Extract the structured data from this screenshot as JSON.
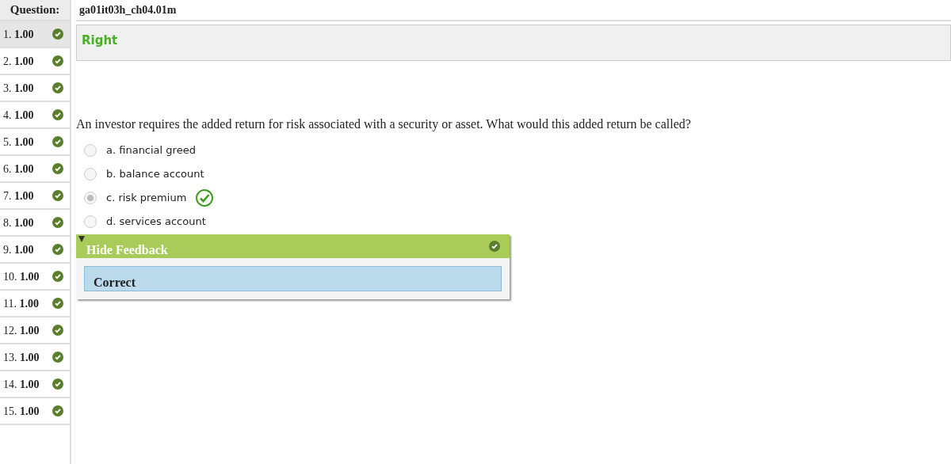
{
  "sidebar": {
    "heading": "Question:",
    "questions": [
      {
        "number": "1.",
        "score": "1.00",
        "correct": true,
        "selected": true
      },
      {
        "number": "2.",
        "score": "1.00",
        "correct": true,
        "selected": false
      },
      {
        "number": "3.",
        "score": "1.00",
        "correct": true,
        "selected": false
      },
      {
        "number": "4.",
        "score": "1.00",
        "correct": true,
        "selected": false
      },
      {
        "number": "5.",
        "score": "1.00",
        "correct": true,
        "selected": false
      },
      {
        "number": "6.",
        "score": "1.00",
        "correct": true,
        "selected": false
      },
      {
        "number": "7.",
        "score": "1.00",
        "correct": true,
        "selected": false
      },
      {
        "number": "8.",
        "score": "1.00",
        "correct": true,
        "selected": false
      },
      {
        "number": "9.",
        "score": "1.00",
        "correct": true,
        "selected": false
      },
      {
        "number": "10.",
        "score": "1.00",
        "correct": true,
        "selected": false
      },
      {
        "number": "11.",
        "score": "1.00",
        "correct": true,
        "selected": false
      },
      {
        "number": "12.",
        "score": "1.00",
        "correct": true,
        "selected": false
      },
      {
        "number": "13.",
        "score": "1.00",
        "correct": true,
        "selected": false
      },
      {
        "number": "14.",
        "score": "1.00",
        "correct": true,
        "selected": false
      },
      {
        "number": "15.",
        "score": "1.00",
        "correct": true,
        "selected": false
      }
    ]
  },
  "question_id": "ga01it03h_ch04.01m",
  "result": "Right",
  "question": "An investor requires the added return for risk associated with a security or asset. What would this added return be called?",
  "options": [
    {
      "label": "a. financial greed",
      "selected": false,
      "correct": false
    },
    {
      "label": "b. balance account",
      "selected": false,
      "correct": false
    },
    {
      "label": "c. risk premium",
      "selected": true,
      "correct": true
    },
    {
      "label": "d. services account",
      "selected": false,
      "correct": false
    }
  ],
  "feedback": {
    "title": "Hide Feedback",
    "expanded": true,
    "correct": true,
    "text": "Correct"
  }
}
